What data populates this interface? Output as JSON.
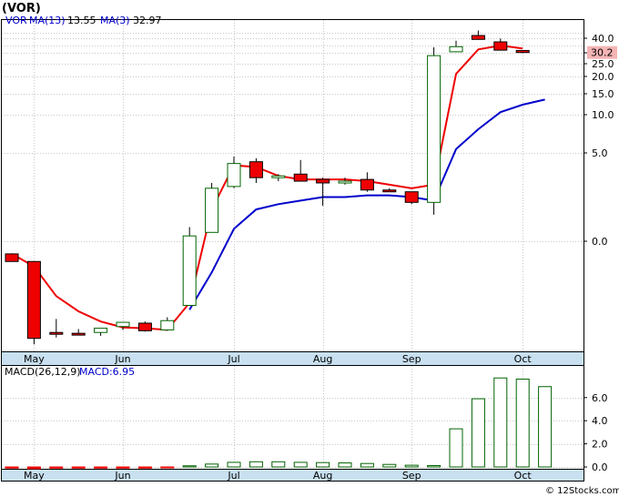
{
  "chart_data": [
    {
      "type": "candlestick",
      "symbol_title": "(VOR)",
      "legend": {
        "symbol": "VOR",
        "ma13_label": "MA(13)",
        "ma13_value": "13.55",
        "ma3_label": "MA(3)",
        "ma3_value": "32.97"
      },
      "y_tick_labels": [
        "40.0",
        "30.0",
        "25.0",
        "20.0",
        "15.0",
        "10.0",
        "5.0",
        "0.0"
      ],
      "y_tick_values": [
        40,
        30,
        25,
        20,
        15,
        10,
        5,
        0
      ],
      "extra_gridlines": [
        45,
        35
      ],
      "last_price": "30.2",
      "x_tick_labels": [
        "May",
        "Jun",
        "Jul",
        "Aug",
        "Sep",
        "Oct"
      ],
      "x_tick_slots": [
        1,
        5,
        10,
        14,
        18,
        23
      ],
      "bar_count": 25,
      "candles": [
        {
          "o": -1.5,
          "h": -1.5,
          "l": -2.4,
          "c": -2.4,
          "up": false
        },
        {
          "o": -2.4,
          "h": -2.5,
          "l": -12.2,
          "c": -11.5,
          "up": false
        },
        {
          "o": -10.8,
          "h": -9.2,
          "l": -11.4,
          "c": -10.8,
          "up": false
        },
        {
          "o": -10.9,
          "h": -10.4,
          "l": -11.1,
          "c": -10.9,
          "up": false
        },
        {
          "o": -10.8,
          "h": -10.3,
          "l": -11.2,
          "c": -10.3,
          "up": true
        },
        {
          "o": -10.1,
          "h": -9.6,
          "l": -10.5,
          "c": -9.6,
          "up": true
        },
        {
          "o": -9.7,
          "h": -9.5,
          "l": -10.7,
          "c": -10.6,
          "up": false
        },
        {
          "o": -10.5,
          "h": -9.0,
          "l": -10.6,
          "c": -9.4,
          "up": true
        },
        {
          "o": -7.6,
          "h": 0.8,
          "l": -7.6,
          "c": 0.3,
          "up": true
        },
        {
          "o": 0.5,
          "h": 3.3,
          "l": 0.5,
          "c": 3.0,
          "up": true
        },
        {
          "o": 3.1,
          "h": 4.8,
          "l": 3.0,
          "c": 4.4,
          "up": true
        },
        {
          "o": 4.5,
          "h": 4.7,
          "l": 3.3,
          "c": 3.6,
          "up": false
        },
        {
          "o": 3.7,
          "h": 3.8,
          "l": 3.4,
          "c": 3.6,
          "up": true
        },
        {
          "o": 3.8,
          "h": 4.6,
          "l": 3.4,
          "c": 3.4,
          "up": false
        },
        {
          "o": 3.5,
          "h": 3.6,
          "l": 2.0,
          "c": 3.3,
          "up": false
        },
        {
          "o": 3.4,
          "h": 3.6,
          "l": 3.2,
          "c": 3.4,
          "up": true
        },
        {
          "o": 3.5,
          "h": 3.9,
          "l": 2.8,
          "c": 2.9,
          "up": false
        },
        {
          "o": 2.9,
          "h": 3.0,
          "l": 2.8,
          "c": 2.8,
          "up": false
        },
        {
          "o": 2.8,
          "h": 2.8,
          "l": 2.1,
          "c": 2.2,
          "up": false
        },
        {
          "o": 2.2,
          "h": 33.8,
          "l": 1.5,
          "c": 28.7,
          "up": true
        },
        {
          "o": 30.7,
          "h": 38.3,
          "l": 30.5,
          "c": 34.2,
          "up": true
        },
        {
          "o": 42.5,
          "h": 47.5,
          "l": 39.0,
          "c": 39.2,
          "up": false
        },
        {
          "o": 37.5,
          "h": 39.8,
          "l": 31.6,
          "c": 31.8,
          "up": false
        },
        {
          "o": 31.6,
          "h": 31.7,
          "l": 29.9,
          "c": 30.2,
          "up": false
        }
      ],
      "ma3_line": [
        -1.5,
        -3.0,
        -6.5,
        -8.3,
        -9.5,
        -10.2,
        -10.3,
        -10.5,
        -7.3,
        1.8,
        4.3,
        4.2,
        3.7,
        3.5,
        3.5,
        3.5,
        3.4,
        3.2,
        3.0,
        3.2,
        21.0,
        32.3,
        35.0,
        33.0
      ],
      "ma13_line": [
        null,
        null,
        null,
        null,
        null,
        null,
        null,
        null,
        -8.1,
        -3.7,
        0.7,
        1.8,
        2.1,
        2.3,
        2.5,
        2.5,
        2.6,
        2.6,
        2.5,
        2.3,
        5.5,
        8.1,
        10.6,
        12.4,
        13.6
      ],
      "macd_legend": {
        "label": "MACD(26,12,9)",
        "value_label": "MACD:6.95"
      },
      "macd_y_tick_labels": [
        "6.0",
        "4.0",
        "2.0",
        "0.0"
      ],
      "macd_y_tick_values": [
        6,
        4,
        2,
        0
      ],
      "macd_bars": [
        -0.1,
        -0.15,
        -0.1,
        -0.1,
        -0.1,
        -0.1,
        -0.1,
        -0.05,
        0.1,
        0.25,
        0.4,
        0.45,
        0.45,
        0.4,
        0.38,
        0.35,
        0.3,
        0.22,
        0.15,
        0.12,
        3.3,
        5.9,
        7.7,
        7.6,
        6.95
      ],
      "credit": "© 12Stocks.com",
      "colors": {
        "up_outline": "#006400",
        "down_fill": "#ee0000",
        "ma3": "#ee0000",
        "ma13": "#0000cc",
        "last_price_bg": "#f4b4b4",
        "axis_strip": "#c8e0f0"
      }
    }
  ]
}
